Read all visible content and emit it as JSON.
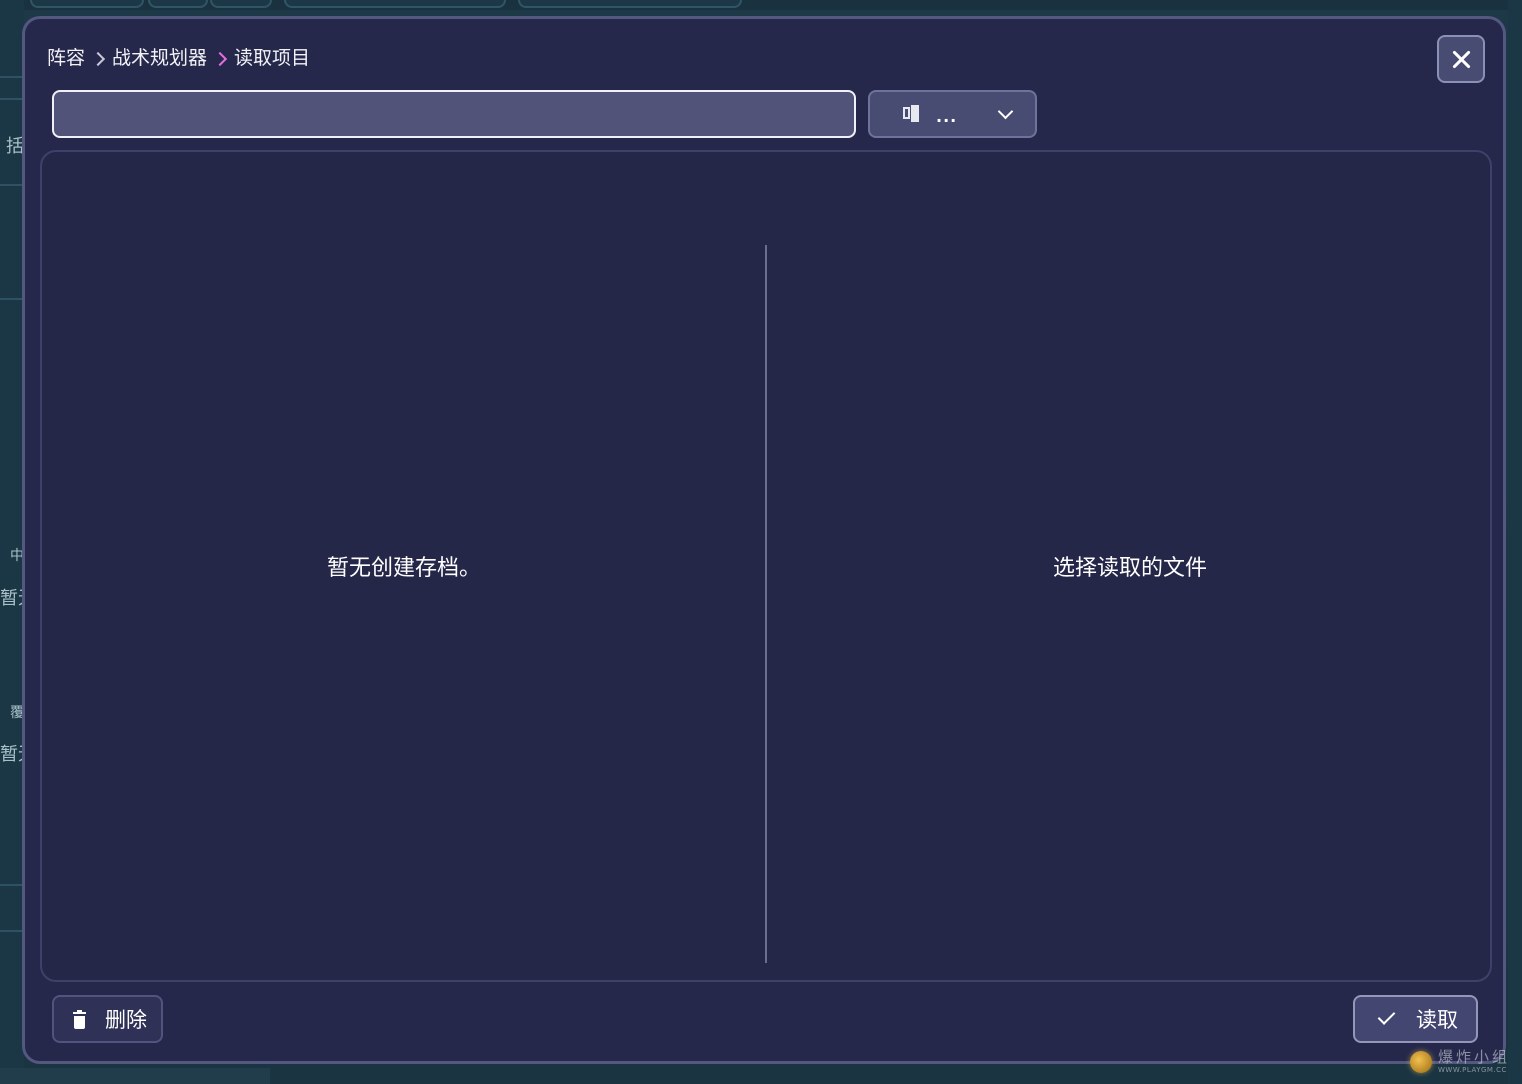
{
  "breadcrumb": {
    "items": [
      "阵容",
      "战术规划器",
      "读取项目"
    ]
  },
  "search": {
    "value": "",
    "placeholder": ""
  },
  "sort_dropdown": {
    "icon": "sort-icon",
    "value": "..."
  },
  "left_pane": {
    "empty_message": "暂无创建存档。"
  },
  "right_pane": {
    "placeholder_message": "选择读取的文件"
  },
  "footer": {
    "delete_label": "删除",
    "load_label": "读取"
  },
  "background": {
    "left_fragments": [
      "括",
      "中",
      "暂无",
      "覆",
      "暂无"
    ]
  },
  "watermark": {
    "text": "爆炸小组",
    "sub": "WWW.PLAYGM.CC"
  },
  "colors": {
    "modal_bg": "#25284b",
    "modal_border": "#54577f",
    "breadcrumb_active_sep": "#e76de0",
    "input_bg": "#515379"
  }
}
